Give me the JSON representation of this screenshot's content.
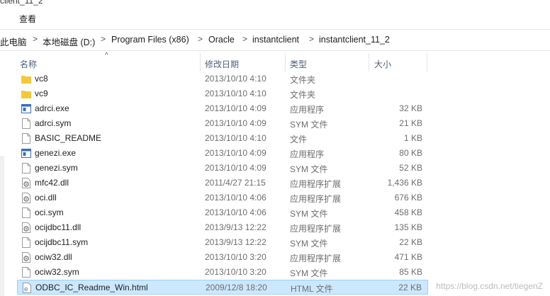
{
  "window": {
    "title_fragment": "client_11_2"
  },
  "menubar": {
    "view_label": "查看"
  },
  "address": {
    "crumbs": [
      "此电脑",
      "本地磁盘 (D:)",
      "Program Files (x86)",
      "Oracle",
      "instantclient",
      "instantclient_11_2"
    ],
    "separator": ">"
  },
  "columns": {
    "name": "名称",
    "date": "修改日期",
    "type": "类型",
    "size": "大小"
  },
  "files": [
    {
      "name": "vc8",
      "date": "2013/10/10 4:10",
      "type": "文件夹",
      "size": "",
      "icon": "folder-icon"
    },
    {
      "name": "vc9",
      "date": "2013/10/10 4:10",
      "type": "文件夹",
      "size": "",
      "icon": "folder-icon"
    },
    {
      "name": "adrci.exe",
      "date": "2013/10/10 4:09",
      "type": "应用程序",
      "size": "32 KB",
      "icon": "exe-icon"
    },
    {
      "name": "adrci.sym",
      "date": "2013/10/10 4:09",
      "type": "SYM 文件",
      "size": "21 KB",
      "icon": "file-icon"
    },
    {
      "name": "BASIC_README",
      "date": "2013/10/10 4:10",
      "type": "文件",
      "size": "1 KB",
      "icon": "file-icon"
    },
    {
      "name": "genezi.exe",
      "date": "2013/10/10 4:09",
      "type": "应用程序",
      "size": "80 KB",
      "icon": "exe-icon"
    },
    {
      "name": "genezi.sym",
      "date": "2013/10/10 4:09",
      "type": "SYM 文件",
      "size": "52 KB",
      "icon": "file-icon"
    },
    {
      "name": "mfc42.dll",
      "date": "2011/4/27 21:15",
      "type": "应用程序扩展",
      "size": "1,436 KB",
      "icon": "dll-icon"
    },
    {
      "name": "oci.dll",
      "date": "2013/10/10 4:06",
      "type": "应用程序扩展",
      "size": "676 KB",
      "icon": "dll-icon"
    },
    {
      "name": "oci.sym",
      "date": "2013/10/10 4:06",
      "type": "SYM 文件",
      "size": "458 KB",
      "icon": "file-icon"
    },
    {
      "name": "ocijdbc11.dll",
      "date": "2013/9/13 12:22",
      "type": "应用程序扩展",
      "size": "135 KB",
      "icon": "dll-icon"
    },
    {
      "name": "ocijdbc11.sym",
      "date": "2013/9/13 12:22",
      "type": "SYM 文件",
      "size": "22 KB",
      "icon": "file-icon"
    },
    {
      "name": "ociw32.dll",
      "date": "2013/10/10 3:20",
      "type": "应用程序扩展",
      "size": "471 KB",
      "icon": "dll-icon"
    },
    {
      "name": "ociw32.sym",
      "date": "2013/10/10 3:20",
      "type": "SYM 文件",
      "size": "85 KB",
      "icon": "file-icon"
    },
    {
      "name": "ODBC_IC_Readme_Win.html",
      "date": "2009/12/8 18:20",
      "type": "HTML 文件",
      "size": "22 KB",
      "icon": "html-icon",
      "selected": true
    }
  ],
  "watermark": "https://blog.csdn.net/tiegenZ",
  "colors": {
    "selection": "#cce8ff",
    "selection_border": "#99d1ff",
    "folder": "#f4c83a",
    "header_text": "#4c607a"
  }
}
